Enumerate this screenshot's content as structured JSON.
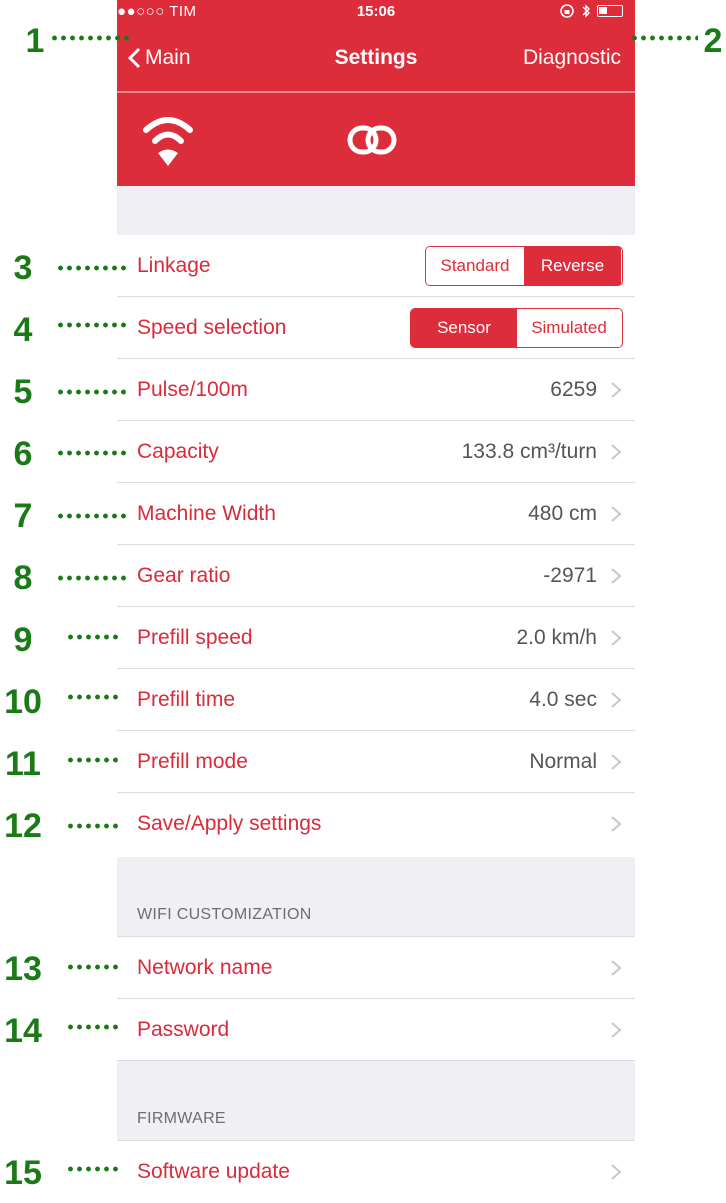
{
  "status_bar": {
    "carrier": "●●○○○ TIM",
    "time": "15:06"
  },
  "nav": {
    "back_label": "Main",
    "title": "Settings",
    "right_label": "Diagnostic"
  },
  "icons": {
    "tab1": "wifi-icon",
    "tab2": "link-icon"
  },
  "colors": {
    "accent": "#dd2c3a",
    "annotation": "#1b7a17"
  },
  "settings": {
    "linkage": {
      "label": "Linkage",
      "options": [
        "Standard",
        "Reverse"
      ],
      "selected": "Reverse"
    },
    "speed_selection": {
      "label": "Speed selection",
      "options": [
        "Sensor",
        "Simulated"
      ],
      "selected": "Sensor"
    },
    "rows": [
      {
        "label": "Pulse/100m",
        "value": "6259"
      },
      {
        "label": "Capacity",
        "value": "133.8 cm³/turn"
      },
      {
        "label": "Machine Width",
        "value": "480 cm"
      },
      {
        "label": "Gear ratio",
        "value": "-2971"
      },
      {
        "label": "Prefill speed",
        "value": "2.0 km/h"
      },
      {
        "label": "Prefill time",
        "value": "4.0 sec"
      },
      {
        "label": "Prefill mode",
        "value": "Normal"
      },
      {
        "label": "Save/Apply settings",
        "value": ""
      }
    ]
  },
  "wifi": {
    "header": "WIFI CUSTOMIZATION",
    "rows": [
      {
        "label": "Network name"
      },
      {
        "label": "Password"
      }
    ]
  },
  "firmware": {
    "header": "FIRMWARE",
    "rows": [
      {
        "label": "Software update"
      }
    ]
  },
  "annotations": [
    "1",
    "2",
    "3",
    "4",
    "5",
    "6",
    "7",
    "8",
    "9",
    "10",
    "11",
    "12",
    "13",
    "14",
    "15"
  ]
}
